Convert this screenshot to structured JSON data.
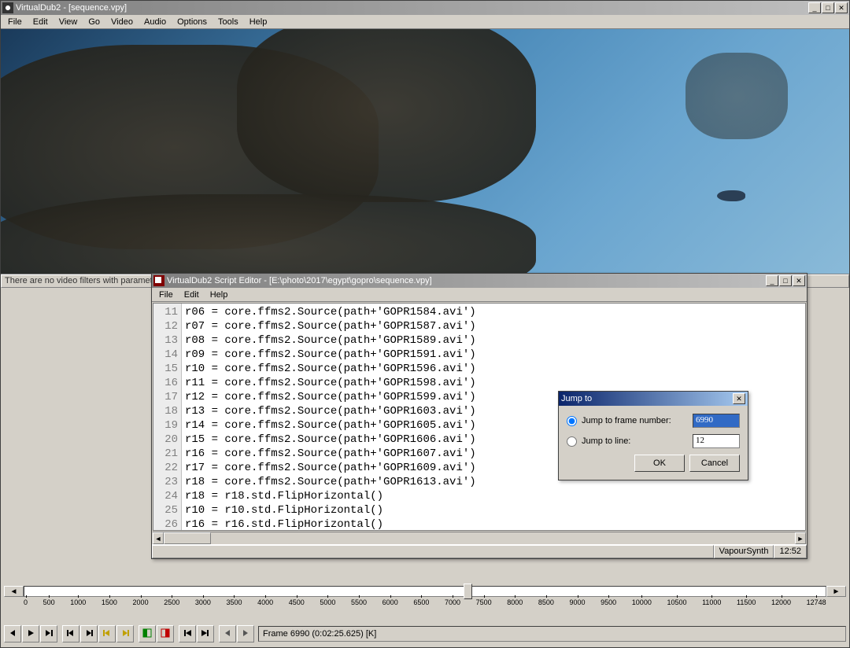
{
  "main_window": {
    "title": "VirtualDub2  - [sequence.vpy]",
    "menu": [
      "File",
      "Edit",
      "View",
      "Go",
      "Video",
      "Audio",
      "Options",
      "Tools",
      "Help"
    ],
    "status_strip": "There are no video filters with paramet"
  },
  "script_editor": {
    "title": "VirtualDub2 Script Editor - [E:\\photo\\2017\\egypt\\gopro\\sequence.vpy]",
    "menu": [
      "File",
      "Edit",
      "Help"
    ],
    "lines": [
      {
        "n": 11,
        "text": "r06 = core.ffms2.Source(path+'GOPR1584.avi')"
      },
      {
        "n": 12,
        "text": "r07 = core.ffms2.Source(path+'GOPR1587.avi')"
      },
      {
        "n": 13,
        "text": "r08 = core.ffms2.Source(path+'GOPR1589.avi')"
      },
      {
        "n": 14,
        "text": "r09 = core.ffms2.Source(path+'GOPR1591.avi')"
      },
      {
        "n": 15,
        "text": "r10 = core.ffms2.Source(path+'GOPR1596.avi')"
      },
      {
        "n": 16,
        "text": "r11 = core.ffms2.Source(path+'GOPR1598.avi')"
      },
      {
        "n": 17,
        "text": "r12 = core.ffms2.Source(path+'GOPR1599.avi')"
      },
      {
        "n": 18,
        "text": "r13 = core.ffms2.Source(path+'GOPR1603.avi')"
      },
      {
        "n": 19,
        "text": "r14 = core.ffms2.Source(path+'GOPR1605.avi')"
      },
      {
        "n": 20,
        "text": "r15 = core.ffms2.Source(path+'GOPR1606.avi')"
      },
      {
        "n": 21,
        "text": "r16 = core.ffms2.Source(path+'GOPR1607.avi')"
      },
      {
        "n": 22,
        "text": "r17 = core.ffms2.Source(path+'GOPR1609.avi')"
      },
      {
        "n": 23,
        "text": "r18 = core.ffms2.Source(path+'GOPR1613.avi')"
      },
      {
        "n": 24,
        "text": "r18 = r18.std.FlipHorizontal()"
      },
      {
        "n": 25,
        "text": "r10 = r10.std.FlipHorizontal()"
      },
      {
        "n": 26,
        "text": "r16 = r16.std.FlipHorizontal()"
      }
    ],
    "status_script_type": "VapourSynth",
    "status_cursor": "12:52"
  },
  "jump_dialog": {
    "title": "Jump to",
    "radio_frame_label": "Jump to frame number:",
    "radio_line_label": "Jump to line:",
    "frame_value": "6990",
    "line_value": "12",
    "ok_label": "OK",
    "cancel_label": "Cancel"
  },
  "timeline": {
    "ticks": [
      "0",
      "500",
      "1000",
      "1500",
      "2000",
      "2500",
      "3000",
      "3500",
      "4000",
      "4500",
      "5000",
      "5500",
      "6000",
      "6500",
      "7000",
      "7500",
      "8000",
      "8500",
      "9000",
      "9500",
      "10000",
      "10500",
      "11000",
      "11500",
      "12000"
    ],
    "end_label": "12748",
    "scrubber_fraction": 0.548
  },
  "frame_status": "Frame 6990 (0:02:25.625) [K]",
  "toolbar_icons": [
    "rewind",
    "play",
    "play-out",
    "step-back",
    "step-fwd",
    "key-back",
    "key-fwd",
    "mark-in",
    "mark-out",
    "go-start",
    "go-end",
    "prev-drop",
    "next-drop"
  ]
}
